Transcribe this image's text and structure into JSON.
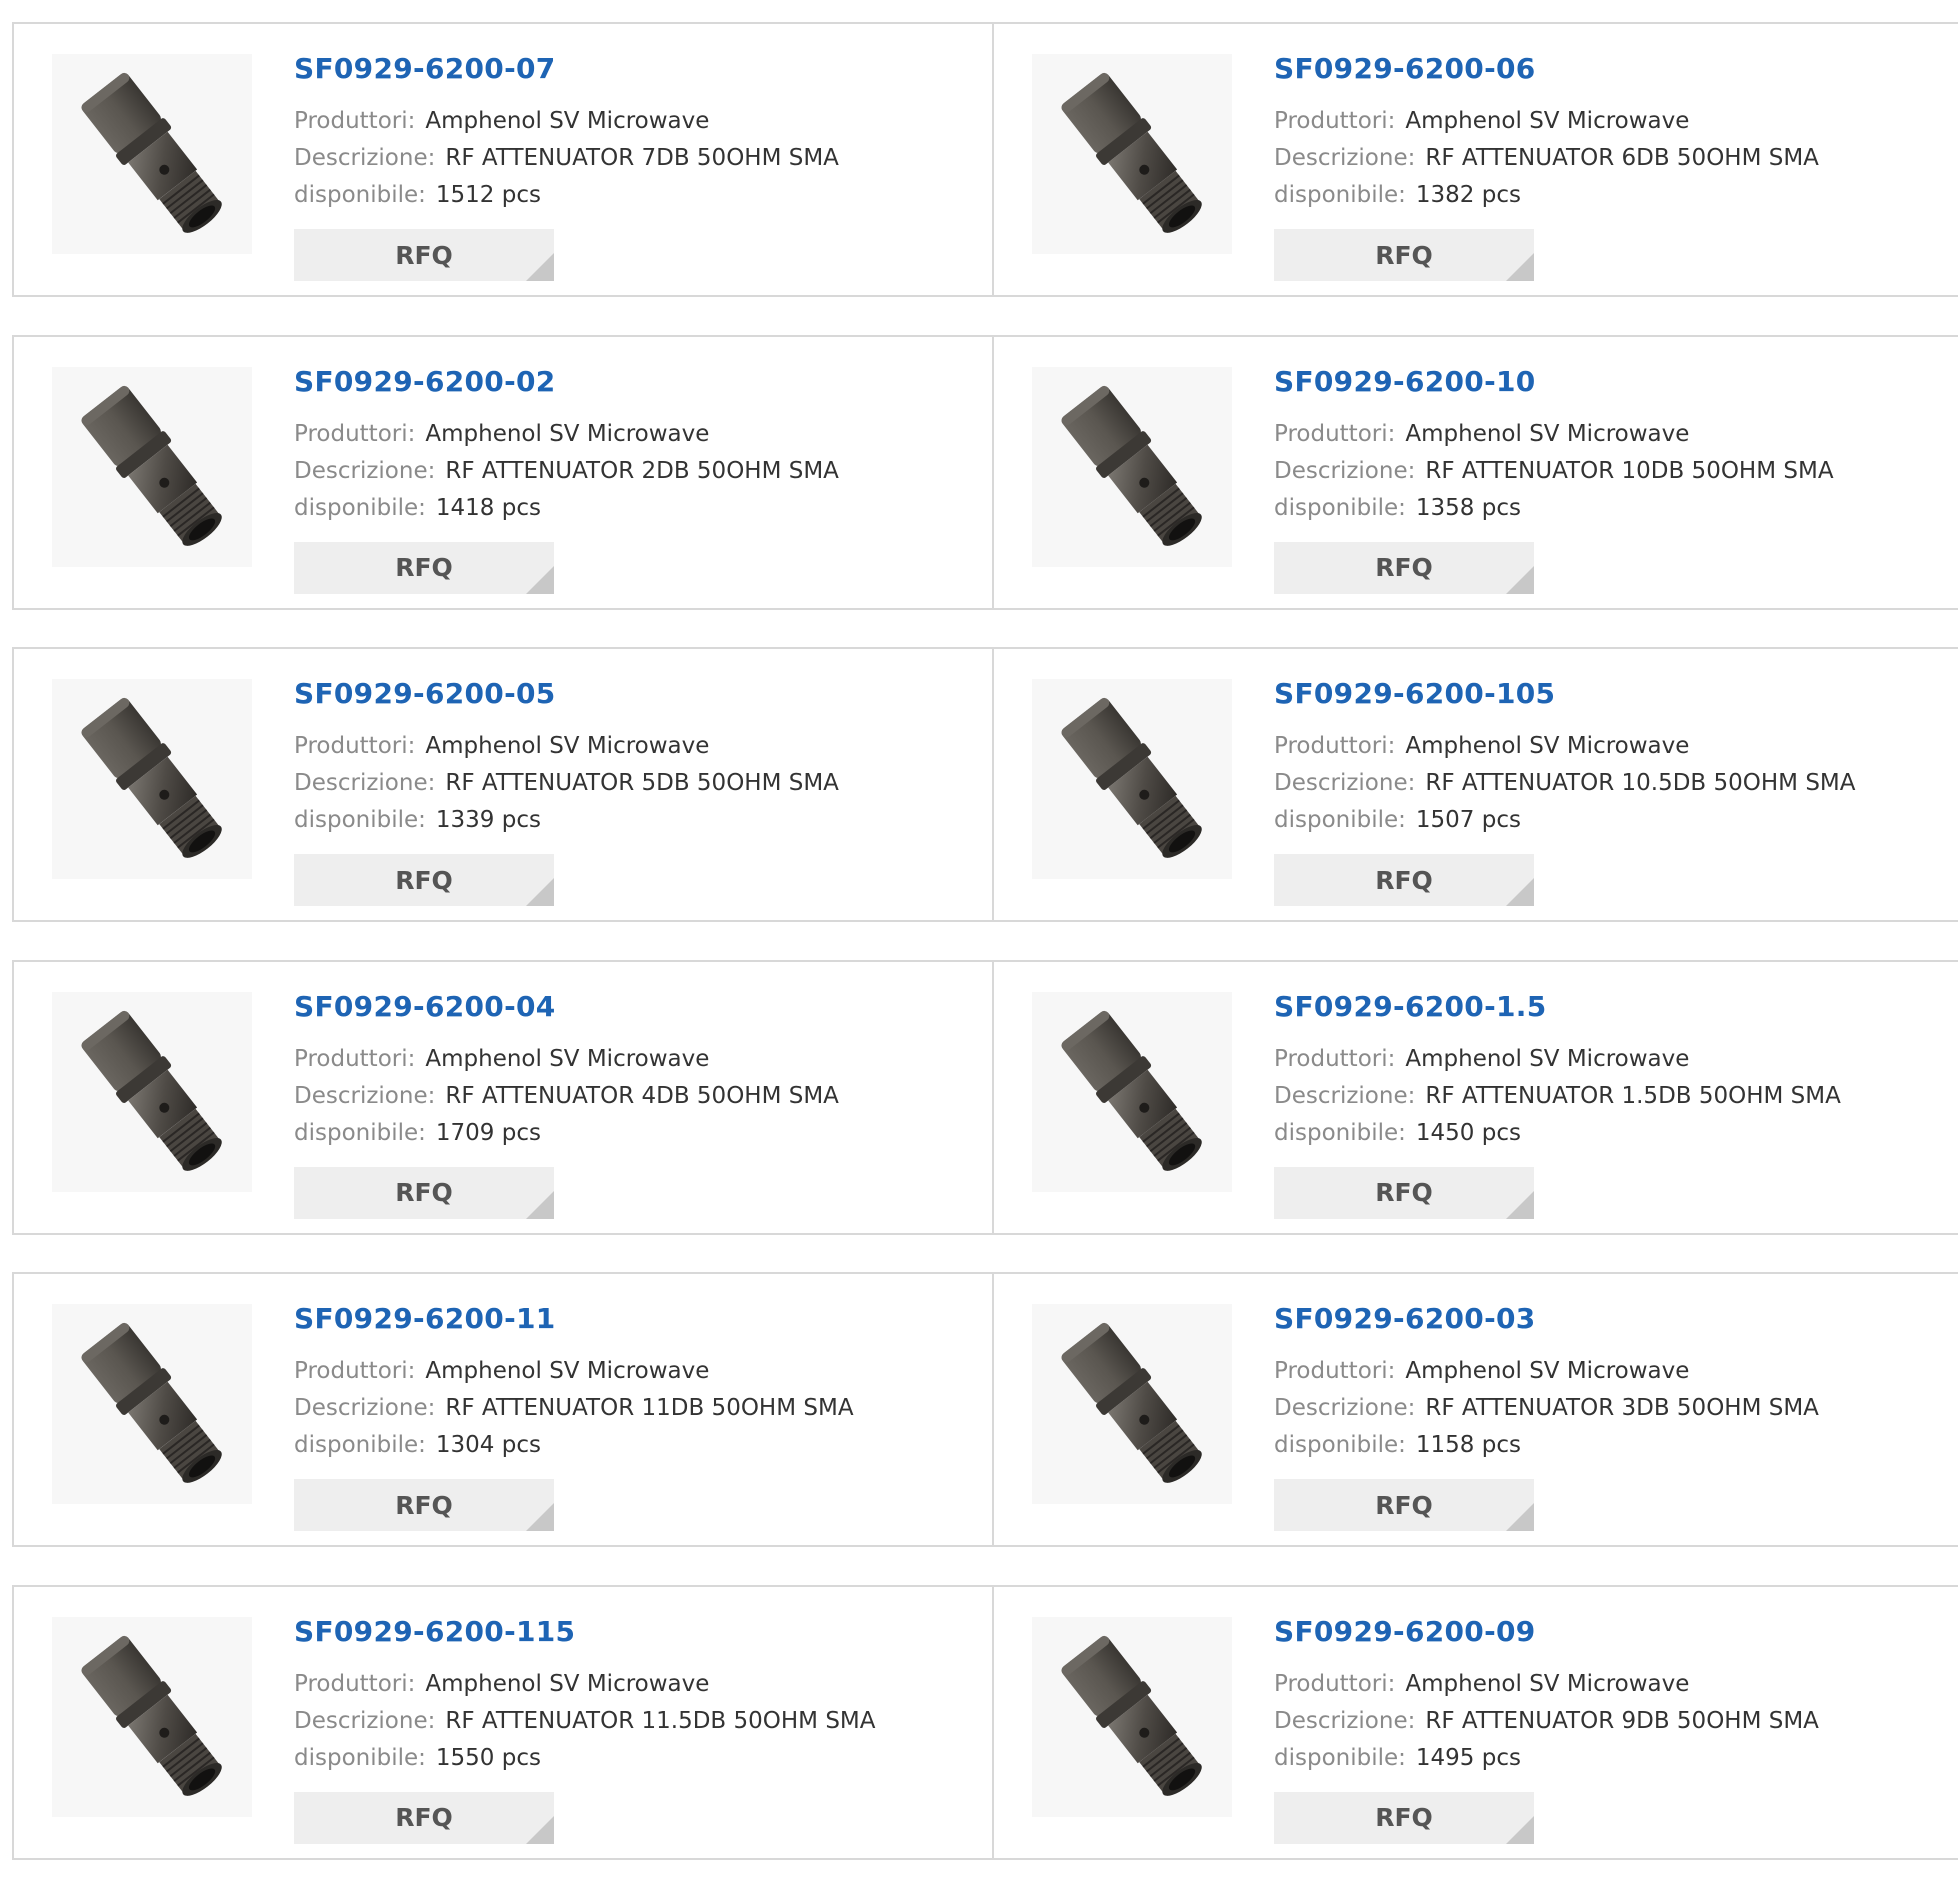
{
  "labels": {
    "manufacturer": "Produttori:",
    "description": "Descrizione:",
    "available": "disponibile:",
    "rfq": "RFQ"
  },
  "colors": {
    "part_number": "#1e64b4",
    "label": "#8a8a8a",
    "border": "#d8d8d8",
    "button_bg": "#eeeeee"
  },
  "icons": {
    "product_image": "sma-attenuator-image",
    "button_corner": "corner-triangle-icon"
  },
  "products": [
    {
      "pn": "SF0929-6200-07",
      "manufacturer": "Amphenol SV Microwave",
      "description": "RF ATTENUATOR 7DB 50OHM SMA",
      "available": "1512 pcs"
    },
    {
      "pn": "SF0929-6200-06",
      "manufacturer": "Amphenol SV Microwave",
      "description": "RF ATTENUATOR 6DB 50OHM SMA",
      "available": "1382 pcs"
    },
    {
      "pn": "SF0929-6200-02",
      "manufacturer": "Amphenol SV Microwave",
      "description": "RF ATTENUATOR 2DB 50OHM SMA",
      "available": "1418 pcs"
    },
    {
      "pn": "SF0929-6200-10",
      "manufacturer": "Amphenol SV Microwave",
      "description": "RF ATTENUATOR 10DB 50OHM SMA",
      "available": "1358 pcs"
    },
    {
      "pn": "SF0929-6200-05",
      "manufacturer": "Amphenol SV Microwave",
      "description": "RF ATTENUATOR 5DB 50OHM SMA",
      "available": "1339 pcs"
    },
    {
      "pn": "SF0929-6200-105",
      "manufacturer": "Amphenol SV Microwave",
      "description": "RF ATTENUATOR 10.5DB 50OHM SMA",
      "available": "1507 pcs"
    },
    {
      "pn": "SF0929-6200-04",
      "manufacturer": "Amphenol SV Microwave",
      "description": "RF ATTENUATOR 4DB 50OHM SMA",
      "available": "1709 pcs"
    },
    {
      "pn": "SF0929-6200-1.5",
      "manufacturer": "Amphenol SV Microwave",
      "description": "RF ATTENUATOR 1.5DB 50OHM SMA",
      "available": "1450 pcs"
    },
    {
      "pn": "SF0929-6200-11",
      "manufacturer": "Amphenol SV Microwave",
      "description": "RF ATTENUATOR 11DB 50OHM SMA",
      "available": "1304 pcs"
    },
    {
      "pn": "SF0929-6200-03",
      "manufacturer": "Amphenol SV Microwave",
      "description": "RF ATTENUATOR 3DB 50OHM SMA",
      "available": "1158 pcs"
    },
    {
      "pn": "SF0929-6200-115",
      "manufacturer": "Amphenol SV Microwave",
      "description": "RF ATTENUATOR 11.5DB 50OHM SMA",
      "available": "1550 pcs"
    },
    {
      "pn": "SF0929-6200-09",
      "manufacturer": "Amphenol SV Microwave",
      "description": "RF ATTENUATOR 9DB 50OHM SMA",
      "available": "1495 pcs"
    }
  ]
}
